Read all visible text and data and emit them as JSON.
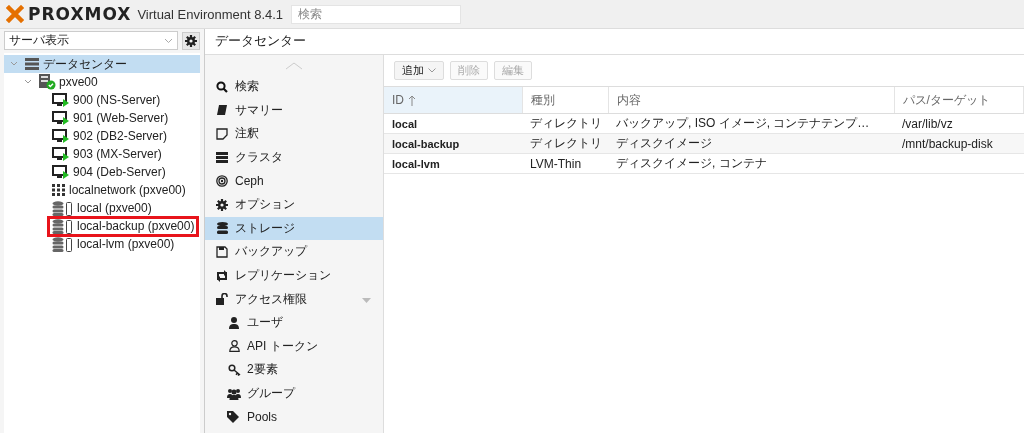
{
  "header": {
    "logo": "PROXMOX",
    "product": "Virtual Environment 8.4.1",
    "search": {
      "placeholder": "検索"
    }
  },
  "sidebar": {
    "view_select": {
      "value": "サーバ表示"
    },
    "tree": [
      {
        "label": "データセンター",
        "kind": "datacenter",
        "selected": true,
        "expanded": true,
        "children": [
          {
            "label": "pxve00",
            "kind": "node",
            "selected": false,
            "expanded": true,
            "annotated": false,
            "children": [
              {
                "label": "900 (NS-Server)",
                "kind": "vm",
                "selected": false,
                "annotated": false
              },
              {
                "label": "901 (Web-Server)",
                "kind": "vm",
                "selected": false,
                "annotated": false
              },
              {
                "label": "902 (DB2-Server)",
                "kind": "vm",
                "selected": false,
                "annotated": false
              },
              {
                "label": "903 (MX-Server)",
                "kind": "vm",
                "selected": false,
                "annotated": false
              },
              {
                "label": "904 (Deb-Server)",
                "kind": "vm",
                "selected": false,
                "annotated": false
              },
              {
                "label": "localnetwork (pxve00)",
                "kind": "network",
                "selected": false,
                "annotated": false
              },
              {
                "label": "local (pxve00)",
                "kind": "storage",
                "selected": false,
                "annotated": false
              },
              {
                "label": "local-backup (pxve00)",
                "kind": "storage",
                "selected": false,
                "annotated": true
              },
              {
                "label": "local-lvm (pxve00)",
                "kind": "storage",
                "selected": false,
                "annotated": false
              }
            ]
          }
        ]
      }
    ]
  },
  "content": {
    "title": "データセンター",
    "nav": [
      {
        "label": "検索",
        "kind": "search",
        "selected": false
      },
      {
        "label": "サマリー",
        "kind": "book",
        "selected": false
      },
      {
        "label": "注釈",
        "kind": "note",
        "selected": false
      },
      {
        "label": "クラスタ",
        "kind": "server",
        "selected": false
      },
      {
        "label": "Ceph",
        "kind": "ceph",
        "selected": false
      },
      {
        "label": "オプション",
        "kind": "gear",
        "selected": false
      },
      {
        "label": "ストレージ",
        "kind": "database",
        "selected": true
      },
      {
        "label": "バックアップ",
        "kind": "floppy",
        "selected": false
      },
      {
        "label": "レプリケーション",
        "kind": "retweet",
        "selected": false
      },
      {
        "label": "アクセス権限",
        "kind": "unlock",
        "selected": false,
        "expanded": true,
        "children": [
          {
            "label": "ユーザ",
            "kind": "user",
            "selected": false
          },
          {
            "label": "API トークン",
            "kind": "user-outline",
            "selected": false
          },
          {
            "label": "2要素",
            "kind": "key",
            "selected": false
          },
          {
            "label": "グループ",
            "kind": "users",
            "selected": false
          },
          {
            "label": "Pools",
            "kind": "tag",
            "selected": false
          }
        ]
      }
    ],
    "toolbar": [
      {
        "label": "追加",
        "kind": "menu",
        "disabled": false
      },
      {
        "label": "削除",
        "kind": "plain",
        "disabled": true
      },
      {
        "label": "編集",
        "kind": "plain",
        "disabled": true
      }
    ],
    "table": {
      "columns": [
        {
          "label": "ID",
          "sorted": true
        },
        {
          "label": "種別",
          "sorted": false
        },
        {
          "label": "内容",
          "sorted": false
        },
        {
          "label": "パス/ターゲット",
          "sorted": false
        }
      ],
      "rows": [
        [
          "local",
          "ディレクトリ",
          "バックアップ, ISO イメージ, コンテナテンプ…",
          "/var/lib/vz"
        ],
        [
          "local-backup",
          "ディレクトリ",
          "ディスクイメージ",
          "/mnt/backup-disk"
        ],
        [
          "local-lvm",
          "LVM-Thin",
          "ディスクイメージ, コンテナ",
          ""
        ]
      ]
    }
  }
}
